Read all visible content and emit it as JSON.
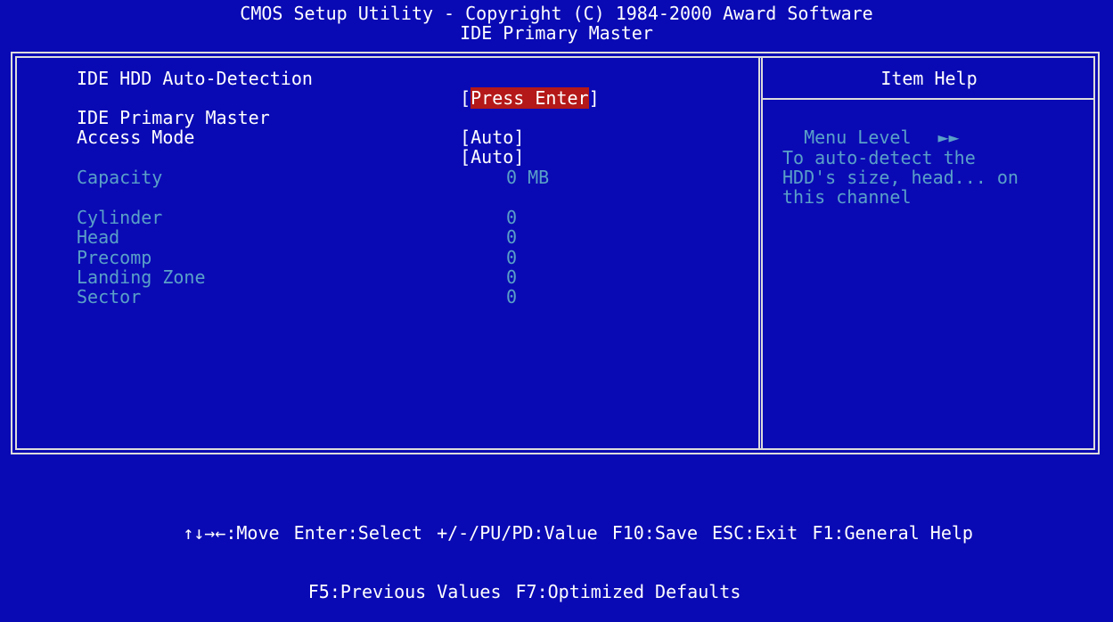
{
  "header": {
    "line1": "CMOS Setup Utility - Copyright (C) 1984-2000 Award Software",
    "line2": "IDE Primary Master"
  },
  "main": {
    "auto_detect": {
      "label": "IDE HDD Auto-Detection",
      "value": "Press Enter"
    },
    "primary_master": {
      "label": "IDE Primary Master",
      "value": "Auto"
    },
    "access_mode": {
      "label": "Access Mode",
      "value": "Auto"
    },
    "capacity": {
      "label": "Capacity",
      "value": "0 MB"
    },
    "cylinder": {
      "label": "Cylinder",
      "value": "0"
    },
    "head": {
      "label": "Head",
      "value": "0"
    },
    "precomp": {
      "label": "Precomp",
      "value": "0"
    },
    "landing_zone": {
      "label": "Landing Zone",
      "value": "0"
    },
    "sector": {
      "label": "Sector",
      "value": "0"
    }
  },
  "help": {
    "title": "Item Help",
    "menu_level": "Menu Level",
    "menu_level_glyph": "►►",
    "lines": [
      "To auto-detect the",
      "HDD's size, head... on",
      "this channel"
    ]
  },
  "footer": {
    "move": "↑↓→←:Move",
    "select": "Enter:Select",
    "value": "+/-/PU/PD:Value",
    "save": "F10:Save",
    "exit": "ESC:Exit",
    "general_help": "F1:General Help",
    "previous": "F5:Previous Values",
    "optimized": "F7:Optimized Defaults"
  },
  "colors": {
    "background": "#0a0ab4",
    "highlight": "#b41818",
    "dim_text": "#5aa0c8",
    "text": "#ffffff"
  }
}
